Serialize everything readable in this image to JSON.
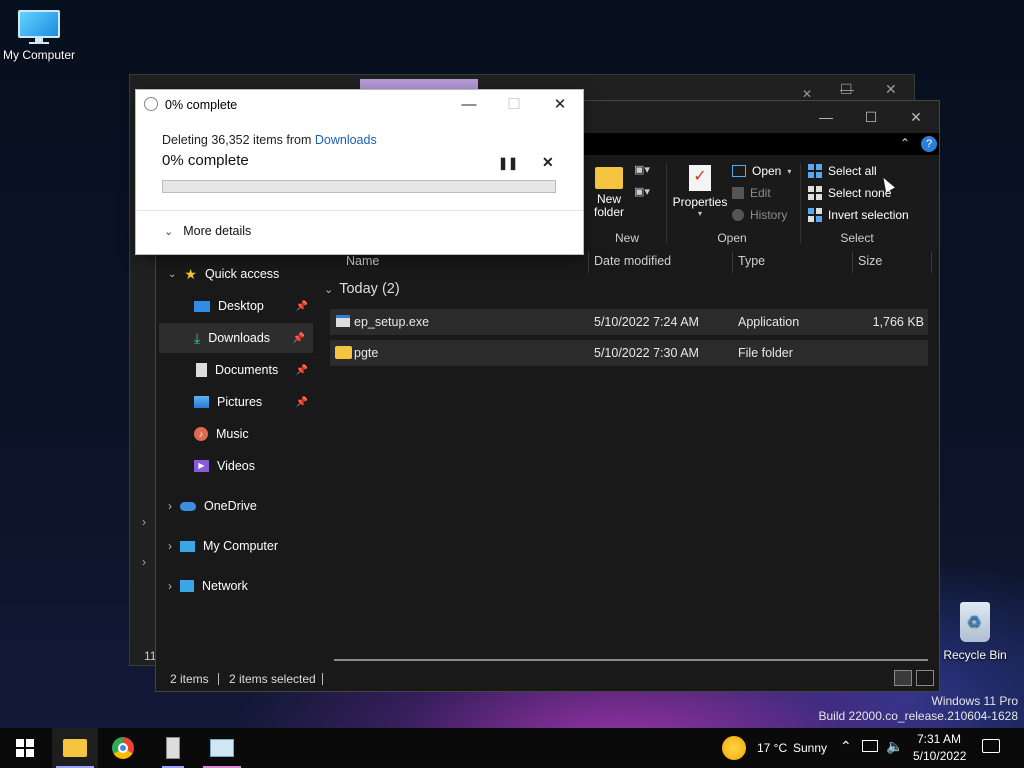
{
  "desktop": {
    "my_computer_label": "My Computer",
    "recycle_bin_label": "Recycle Bin",
    "watermark_line1": "Windows 11 Pro",
    "watermark_line2": "Build 22000.co_release.210604-1628"
  },
  "background_window": {
    "status_count": "11"
  },
  "explorer": {
    "ribbon": {
      "new_group_label": "New",
      "new_folder_label_1": "New",
      "new_folder_label_2": "folder",
      "open_group_label": "Open",
      "properties_label": "Properties",
      "open_label": "Open",
      "edit_label": "Edit",
      "history_label": "History",
      "select_group_label": "Select",
      "select_all_label": "Select all",
      "select_none_label": "Select none",
      "invert_selection_label": "Invert selection",
      "help_label": "?"
    },
    "nav": {
      "quick_access": "Quick access",
      "desktop": "Desktop",
      "downloads": "Downloads",
      "documents": "Documents",
      "pictures": "Pictures",
      "music": "Music",
      "videos": "Videos",
      "onedrive": "OneDrive",
      "my_computer": "My Computer",
      "network": "Network"
    },
    "columns": {
      "name": "Name",
      "date_modified": "Date modified",
      "type": "Type",
      "size": "Size"
    },
    "group_header": "Today (2)",
    "files": [
      {
        "name": "ep_setup.exe",
        "date": "5/10/2022 7:24 AM",
        "type": "Application",
        "size": "1,766 KB"
      },
      {
        "name": "pgte",
        "date": "5/10/2022 7:30 AM",
        "type": "File folder",
        "size": ""
      }
    ],
    "status": {
      "items": "2 items",
      "selected": "2 items selected"
    }
  },
  "dialog": {
    "title": "0% complete",
    "line_prefix": "Deleting 36,352 items from",
    "line_link": "Downloads",
    "big_status": "0% complete",
    "progress_fraction": 0.0,
    "more_details": "More details"
  },
  "taskbar": {
    "weather_temp": "17 °C",
    "weather_text": "Sunny",
    "time": "7:31 AM",
    "date": "5/10/2022"
  },
  "colors": {
    "accent": "#5aa9f0",
    "progress_green": "#06b025",
    "link": "#1a5fb4"
  }
}
